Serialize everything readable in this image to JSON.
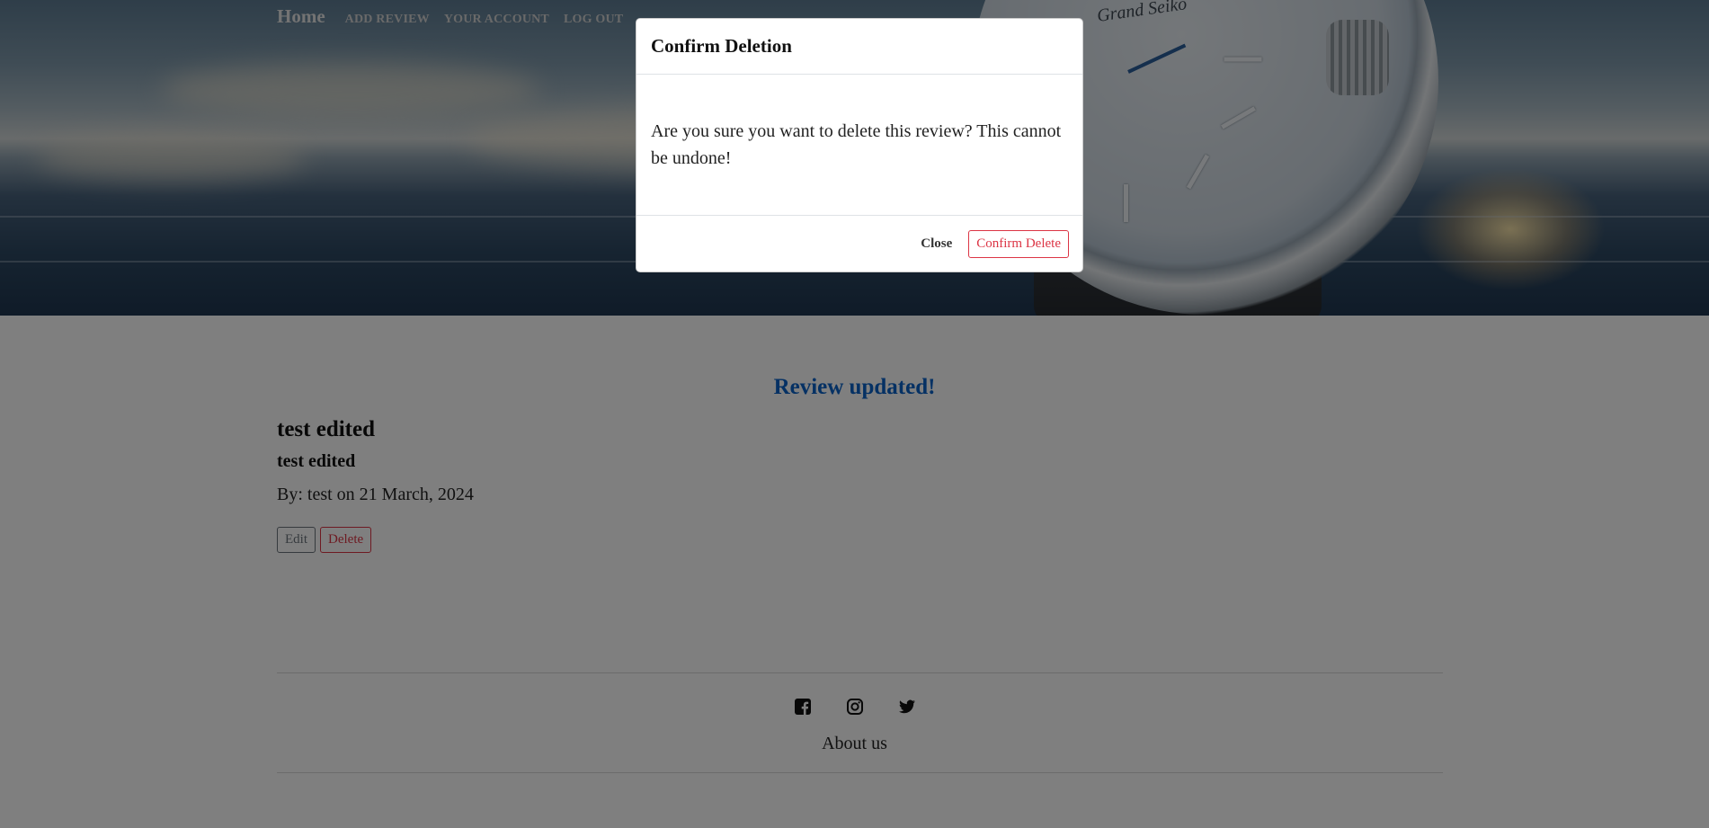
{
  "nav": {
    "brand": "Home",
    "links": [
      "ADD REVIEW",
      "YOUR ACCOUNT",
      "LOG OUT"
    ]
  },
  "hero": {
    "dial_text": "Grand Seiko"
  },
  "flash": {
    "message": "Review updated!"
  },
  "review": {
    "title": "test edited",
    "subtitle": "test edited",
    "meta": "By: test on 21 March, 2024",
    "edit_label": "Edit",
    "delete_label": "Delete"
  },
  "footer": {
    "social_icons": [
      "facebook-icon",
      "instagram-icon",
      "twitter-icon"
    ],
    "about_label": "About us"
  },
  "modal": {
    "title": "Confirm Deletion",
    "body": "Are you sure you want to delete this review? This cannot be undone!",
    "close_label": "Close",
    "confirm_label": "Confirm Delete"
  },
  "colors": {
    "flash": "#0b63c8",
    "danger": "#dc3545",
    "secondary": "#6c757d",
    "backdrop": "rgba(0,0,0,0.5)"
  }
}
